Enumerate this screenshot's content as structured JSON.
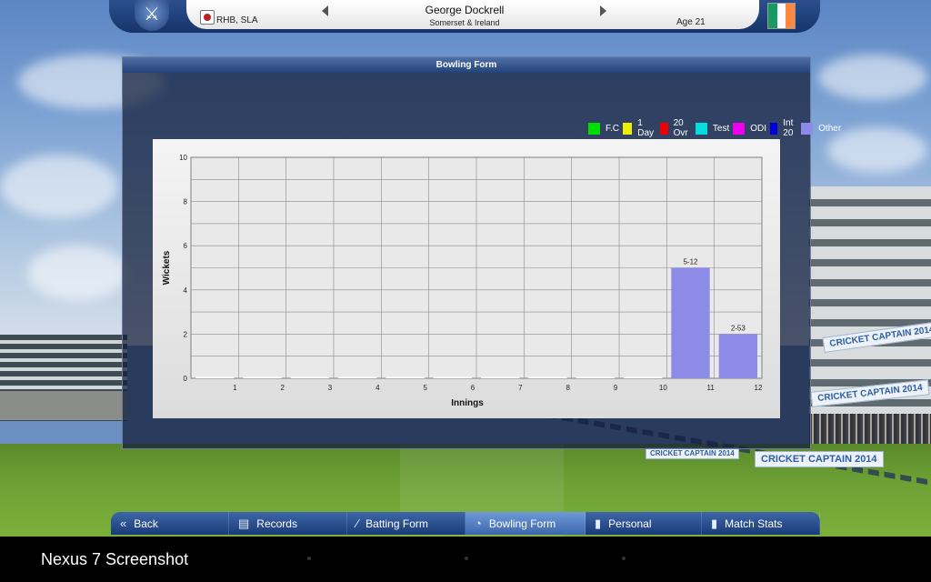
{
  "header": {
    "player_name": "George Dockrell",
    "player_team": "Somerset & Ireland",
    "handedness": "RHB, SLA",
    "age": "Age 21",
    "flag_colors": [
      "#169b62",
      "#ffffff",
      "#ff883e"
    ]
  },
  "panel": {
    "title": "Bowling Form"
  },
  "legend": [
    {
      "label": "F.C",
      "color": "#00dd00"
    },
    {
      "label": "1 Day",
      "color": "#eeee00"
    },
    {
      "label": "20 Ovr",
      "color": "#ee0000"
    },
    {
      "label": "Test",
      "color": "#00dddd"
    },
    {
      "label": "ODI",
      "color": "#ee00ee"
    },
    {
      "label": "Int 20",
      "color": "#0000dd"
    },
    {
      "label": "Other",
      "color": "#8c8ce8"
    }
  ],
  "chart_data": {
    "type": "bar",
    "xlabel": "Innings",
    "ylabel": "Wickets",
    "ylim": [
      0,
      10
    ],
    "yticks": [
      0,
      2,
      4,
      6,
      8,
      10
    ],
    "categories": [
      "1",
      "2",
      "3",
      "4",
      "5",
      "6",
      "7",
      "8",
      "9",
      "10",
      "11",
      "12"
    ],
    "series": [
      {
        "name": "Other",
        "color": "#8c8ce8",
        "values": [
          0,
          0,
          0,
          0,
          0,
          0,
          0,
          0,
          0,
          0,
          5,
          2
        ],
        "labels": [
          "",
          "",
          "",
          "",
          "",
          "",
          "",
          "",
          "",
          "",
          "5-12",
          "2-53"
        ]
      }
    ],
    "grid": true,
    "legend_position": "top-right"
  },
  "nav": {
    "items": [
      {
        "label": "Back",
        "icon": "back-arrows-icon",
        "active": false
      },
      {
        "label": "Records",
        "icon": "records-icon",
        "active": false
      },
      {
        "label": "Batting Form",
        "icon": "batting-form-icon",
        "active": false
      },
      {
        "label": "Bowling Form",
        "icon": "bowling-form-icon",
        "active": true
      },
      {
        "label": "Personal",
        "icon": "personal-icon",
        "active": false
      },
      {
        "label": "Match Stats",
        "icon": "match-stats-icon",
        "active": false
      }
    ]
  },
  "background": {
    "banners": [
      "CRICKET CAPTAIN 2014",
      "CRICKET CAPTAIN 2014",
      "CRICKET CAPTAIN 2014",
      "CRICKET CAPTAIN 2014"
    ]
  },
  "system": {
    "caption": "Nexus 7  Screenshot"
  }
}
